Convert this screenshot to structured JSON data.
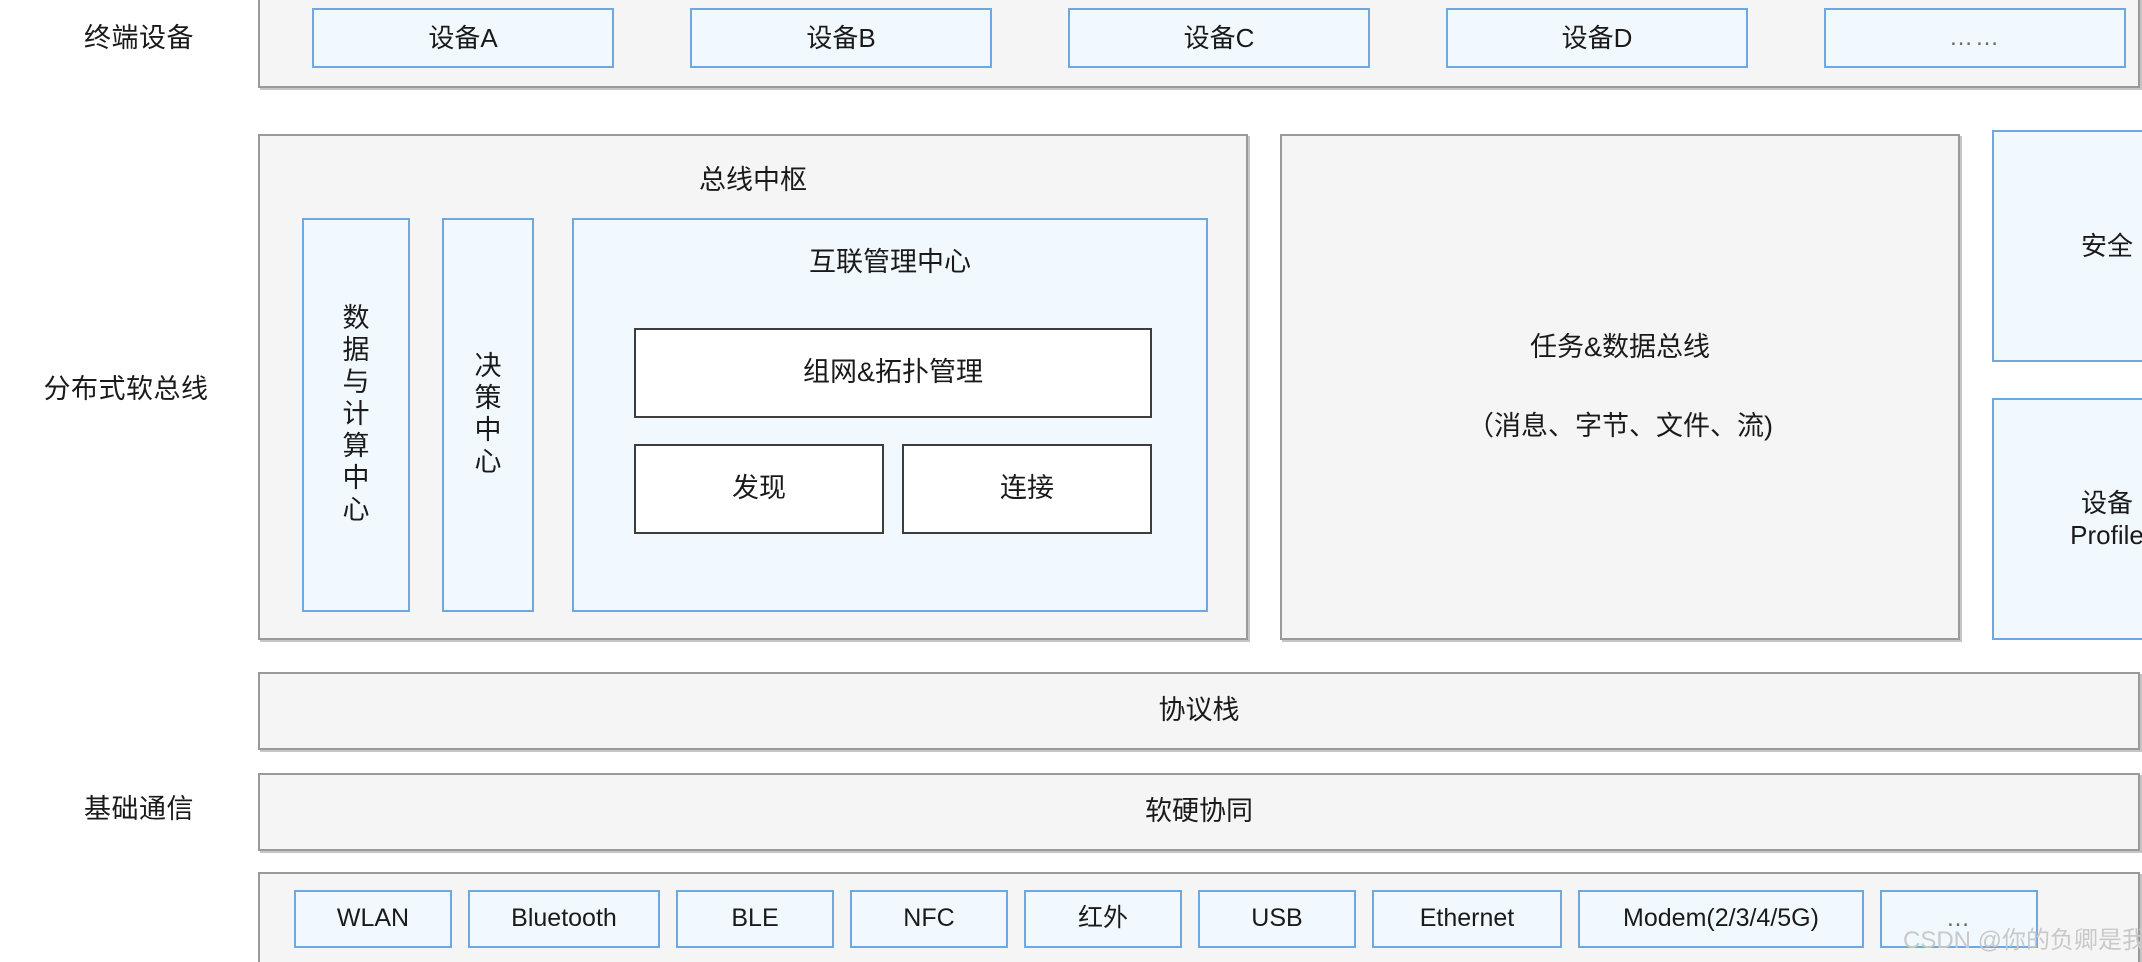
{
  "diagram": {
    "row_labels": {
      "terminal": "终端设备",
      "soft_bus": "分布式软总线",
      "base_comm": "基础通信"
    },
    "terminal_devices": [
      {
        "label": "设备A"
      },
      {
        "label": "设备B"
      },
      {
        "label": "设备C"
      },
      {
        "label": "设备D"
      },
      {
        "label": "……"
      }
    ],
    "bus_hub": {
      "title": "总线中枢",
      "data_compute_center": "数据与计算中心",
      "decision_center": "决策中心",
      "interconnect": {
        "title": "互联管理中心",
        "topology": "组网&拓扑管理",
        "discovery": "发现",
        "connect": "连接"
      }
    },
    "task_data_bus": {
      "line1": "任务&数据总线",
      "line2": "（消息、字节、文件、流)"
    },
    "side_modules": [
      {
        "label": "安全"
      },
      {
        "label": "设备\nProfile"
      }
    ],
    "protocol_stack": "协议栈",
    "hw_sw_collab": "软硬协同",
    "comm_technologies": [
      {
        "label": "WLAN"
      },
      {
        "label": "Bluetooth"
      },
      {
        "label": "BLE"
      },
      {
        "label": "NFC"
      },
      {
        "label": "红外"
      },
      {
        "label": "USB"
      },
      {
        "label": "Ethernet"
      },
      {
        "label": "Modem(2/3/4/5G)"
      },
      {
        "label": "…"
      }
    ],
    "watermark": "CSDN @你的负卿是我",
    "colors": {
      "chip_border": "#6fa8e0",
      "chip_fill": "#f2f9fe",
      "panel_fill": "#f5f5f5",
      "panel_border": "#9a9a9a",
      "box_border": "#3d3d3d",
      "text": "#1a1a1a"
    }
  }
}
